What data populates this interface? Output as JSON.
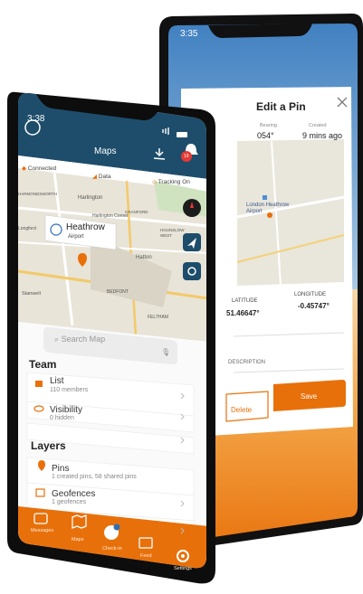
{
  "back_phone": {
    "status_time": "3:35",
    "panel_title": "Edit a Pin",
    "bearing_label": "Bearing",
    "bearing_value": "054°",
    "created_label": "Created",
    "created_value": "9 mins ago",
    "map_label": "London Heathrow Airport",
    "latitude_label": "LATITUDE",
    "latitude_value": "51.46647°",
    "longitude_label": "LONGITUDE",
    "longitude_value": "-0.45747°",
    "description_label": "DESCRIPTION",
    "delete_label": "Delete",
    "save_label": "Save"
  },
  "front_phone": {
    "status_time": "3:38",
    "header_title": "Maps",
    "notification_count": "19",
    "status_connected": "Connected",
    "status_data": "Data",
    "status_tracking": "Tracking On",
    "map_places": [
      "Harlington",
      "HARMONDSWORTH",
      "Harlington Corner",
      "CRANFORD",
      "Longford",
      "HOUNSLOW WEST",
      "Hatton",
      "Stanwell",
      "BEDFONT",
      "FELTHAM"
    ],
    "callout_title": "Heathrow",
    "callout_subtitle": "Airport",
    "search_placeholder": "Search Map",
    "team_heading": "Team",
    "team_items": [
      {
        "label": "List",
        "sub": "110 members"
      },
      {
        "label": "Visibility",
        "sub": "0 hidden"
      }
    ],
    "layers_heading": "Layers",
    "layer_items": [
      {
        "label": "Pins",
        "sub": "1 created pins, 58 shared pins"
      },
      {
        "label": "Geofences",
        "sub": "1 geofences"
      }
    ],
    "tabs": [
      "Messages",
      "Maps",
      "Check-in",
      "Feed",
      "Settings"
    ]
  },
  "colors": {
    "brand_orange": "#e8700a",
    "header_teal": "#1e4d6b",
    "phone_frame": "#111111",
    "map_bg": "#e8e4d8"
  }
}
